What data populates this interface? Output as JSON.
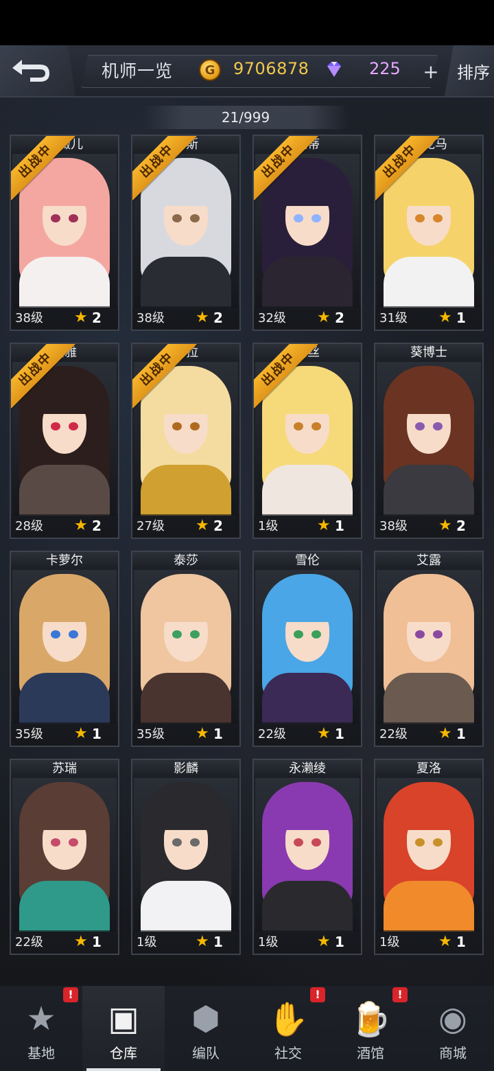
{
  "header": {
    "title": "机师一览",
    "coins": "9706878",
    "gems": "225",
    "plus": "+",
    "sort": "排序"
  },
  "roster_count": "21/999",
  "deploy_ribbon_label": "出战中",
  "pilots": [
    {
      "name": "尼薇儿",
      "level": "38级",
      "stars": "2",
      "deployed": true
    },
    {
      "name": "卡斯",
      "level": "38级",
      "stars": "2",
      "deployed": true
    },
    {
      "name": "妮蒂",
      "level": "32级",
      "stars": "2",
      "deployed": true
    },
    {
      "name": "乔龙马",
      "level": "31级",
      "stars": "1",
      "deployed": true
    },
    {
      "name": "图雅",
      "level": "28级",
      "stars": "2",
      "deployed": true
    },
    {
      "name": "苏拉",
      "level": "27级",
      "stars": "2",
      "deployed": true
    },
    {
      "name": "莉丝",
      "level": "1级",
      "stars": "1",
      "deployed": true
    },
    {
      "name": "葵博士",
      "level": "38级",
      "stars": "2",
      "deployed": false
    },
    {
      "name": "卡萝尔",
      "level": "35级",
      "stars": "1",
      "deployed": false
    },
    {
      "name": "泰莎",
      "level": "35级",
      "stars": "1",
      "deployed": false
    },
    {
      "name": "雪伦",
      "level": "22级",
      "stars": "1",
      "deployed": false
    },
    {
      "name": "艾露",
      "level": "22级",
      "stars": "1",
      "deployed": false
    },
    {
      "name": "苏瑞",
      "level": "22级",
      "stars": "1",
      "deployed": false
    },
    {
      "name": "影麟",
      "level": "1级",
      "stars": "1",
      "deployed": false
    },
    {
      "name": "永濑绫",
      "level": "1级",
      "stars": "1",
      "deployed": false
    },
    {
      "name": "夏洛",
      "level": "1级",
      "stars": "1",
      "deployed": false
    }
  ],
  "portrait_palettes": [
    {
      "hair": "#f4a7a0",
      "eye": "#a0305a",
      "body": "#f5f0f0"
    },
    {
      "hair": "#d8d9df",
      "eye": "#8a6a4a",
      "body": "#2a2c33"
    },
    {
      "hair": "#2a1f3a",
      "eye": "#8fb4ff",
      "body": "#2a2530"
    },
    {
      "hair": "#f6d36a",
      "eye": "#d8862a",
      "body": "#f2f2f2"
    },
    {
      "hair": "#2b1e1c",
      "eye": "#d02a4a",
      "body": "#5a4a45"
    },
    {
      "hair": "#f4dca0",
      "eye": "#b06a20",
      "body": "#d0a030"
    },
    {
      "hair": "#f6da7a",
      "eye": "#c8802a",
      "body": "#f0e6e0"
    },
    {
      "hair": "#6b3322",
      "eye": "#8a5ab0",
      "body": "#3a3a40"
    },
    {
      "hair": "#d9a869",
      "eye": "#3a78d8",
      "body": "#2c3a5a"
    },
    {
      "hair": "#efc6a0",
      "eye": "#3ea060",
      "body": "#4a3430"
    },
    {
      "hair": "#4aa6e6",
      "eye": "#3aa05a",
      "body": "#3a2a55"
    },
    {
      "hair": "#f0bf96",
      "eye": "#8a4aa0",
      "body": "#6a5a50"
    },
    {
      "hair": "#5a3d35",
      "eye": "#c84a6a",
      "body": "#2f9a8a"
    },
    {
      "hair": "#2a2a2e",
      "eye": "#6a6a6a",
      "body": "#f2f2f4"
    },
    {
      "hair": "#8a3ab0",
      "eye": "#c84a5a",
      "body": "#2a2a2e"
    },
    {
      "hair": "#d8432a",
      "eye": "#c8902a",
      "body": "#f08a2a"
    }
  ],
  "nav": [
    {
      "label": "基地",
      "icon": "base-icon",
      "badge": "!"
    },
    {
      "label": "仓库",
      "icon": "warehouse-icon",
      "badge": ""
    },
    {
      "label": "编队",
      "icon": "formation-icon",
      "badge": ""
    },
    {
      "label": "社交",
      "icon": "handshake-icon",
      "badge": "!"
    },
    {
      "label": "酒馆",
      "icon": "tavern-icon",
      "badge": "!"
    },
    {
      "label": "商城",
      "icon": "shop-icon",
      "badge": ""
    }
  ],
  "nav_active_index": 1
}
